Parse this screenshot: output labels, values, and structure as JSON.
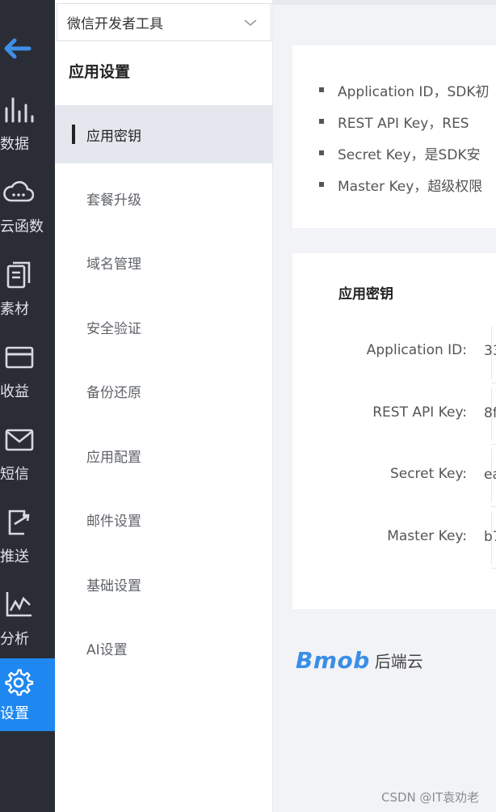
{
  "rail": {
    "items": [
      {
        "label": "数据",
        "icon": "bar-chart-icon"
      },
      {
        "label": "云函数",
        "icon": "cloud-icon"
      },
      {
        "label": "素材",
        "icon": "files-icon"
      },
      {
        "label": "收益",
        "icon": "card-icon"
      },
      {
        "label": "短信",
        "icon": "mail-icon"
      },
      {
        "label": "推送",
        "icon": "push-icon"
      },
      {
        "label": "分析",
        "icon": "line-chart-icon"
      },
      {
        "label": "设置",
        "icon": "gear-icon"
      }
    ],
    "active_color": "#1e88f0"
  },
  "sidebar": {
    "project": "微信开发者工具",
    "title": "应用设置",
    "items": [
      {
        "label": "应用密钥"
      },
      {
        "label": "套餐升级"
      },
      {
        "label": "域名管理"
      },
      {
        "label": "安全验证"
      },
      {
        "label": "备份还原"
      },
      {
        "label": "应用配置"
      },
      {
        "label": "邮件设置"
      },
      {
        "label": "基础设置"
      },
      {
        "label": "AI设置"
      }
    ]
  },
  "notes": [
    "Application ID，SDK初",
    "REST API Key，RES",
    "Secret Key，是SDK安",
    "Master Key，超级权限"
  ],
  "keys": {
    "title": "应用密钥",
    "rows": [
      {
        "label": "Application ID:",
        "value": "33"
      },
      {
        "label": "REST API Key:",
        "value": "8f"
      },
      {
        "label": "Secret Key:",
        "value": "ea"
      },
      {
        "label": "Master Key:",
        "value": "b7"
      }
    ]
  },
  "brand": {
    "logo": "Bmob",
    "sub": "后端云"
  },
  "watermark": "CSDN @IT袁劝老"
}
